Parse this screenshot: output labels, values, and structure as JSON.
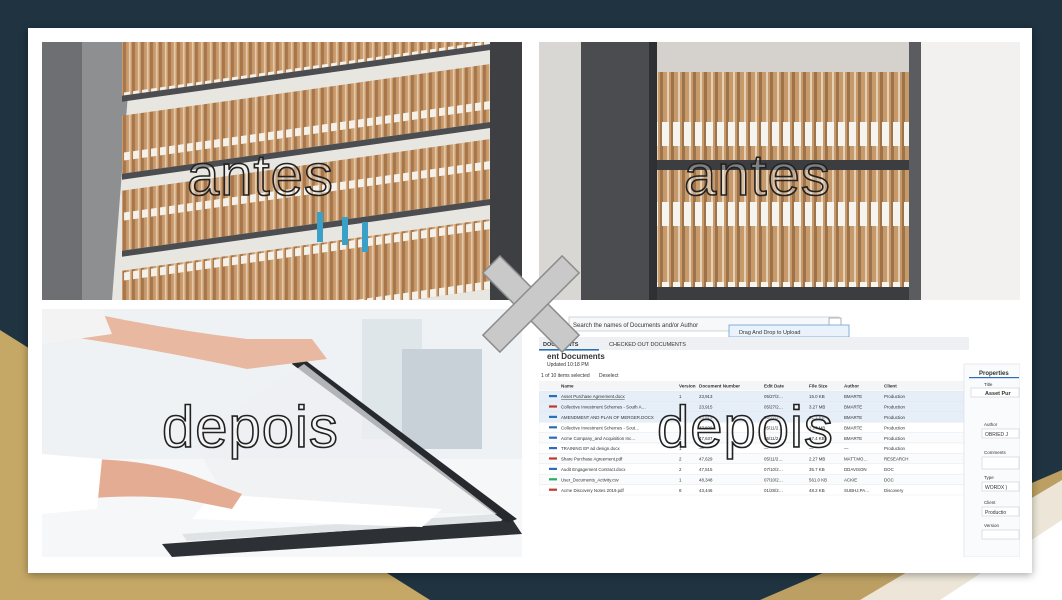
{
  "labels": {
    "before_left": "antes",
    "before_right": "antes",
    "after_left": "depois",
    "after_right": "depois"
  },
  "separator_icon": "x-cross-icon",
  "app_screenshot": {
    "search_placeholder": "Search the names of Documents and/or Author",
    "drop_hint": "Drag And Drop to Upload",
    "tabs": [
      "DOCUMENTS",
      "CHECKED OUT DOCUMENTS"
    ],
    "page_title": "ent Documents",
    "updated": "Updated 10:18 PM",
    "selection_note": "1 of 10 items selected",
    "deselect": "Deselect",
    "columns": [
      "Name",
      "Version",
      "Document Number",
      "Edit Date",
      "File Size",
      "Author",
      "Client"
    ],
    "rows": [
      [
        "Asset Purchase Agreement.docx",
        "1",
        "23,913",
        "05/27/2…",
        "15.0 KB",
        "BMARTE",
        "Production"
      ],
      [
        "Collective Investment Schemes - South A…",
        "1",
        "23,915",
        "05/27/2…",
        "3.27 MB",
        "BMARTE",
        "Production"
      ],
      [
        "AMENDMENT AND PLAN OF MERGER.DOCX",
        "1",
        "23,914",
        "05/27/2…",
        "31.1 KB",
        "BMARTE",
        "Production"
      ],
      [
        "Collective Investment Schemes - Sout…",
        "2",
        "47,829",
        "05/11/2…",
        "3.27 MB",
        "BMARTE",
        "Production"
      ],
      [
        "Acme Company_and Acquisition Inc…",
        "1",
        "47,637",
        "05/11/2…",
        "87.4 KB",
        "BMARTE",
        "Production"
      ],
      [
        "TRAINING EP ad design.docx",
        "1",
        "—",
        "—",
        "—",
        "—",
        "Production"
      ],
      [
        "Share Purchase Agreement.pdf",
        "2",
        "47,629",
        "05/11/2…",
        "2.27 MB",
        "MATT.MO…",
        "RESEARCH"
      ],
      [
        "Audit Engagement Contract.docx",
        "2",
        "47,515",
        "07/10/2…",
        "35.7 KB",
        "DDAVISON",
        "DOC"
      ],
      [
        "User_Documents_Activity.csv",
        "1",
        "48,348",
        "07/10/2…",
        "561.0 KB",
        "ACKIE",
        "DOC"
      ],
      [
        "Acme Discovery Notes 2019.pdf",
        "8",
        "43,446",
        "01/28/2…",
        "48.2 KB",
        "SUBHJ.PA…",
        "Discovery"
      ]
    ],
    "side_panel": {
      "title": "Properties",
      "title_field_label": "Title",
      "title_value": "Asset Pur",
      "author_label": "Author",
      "author_value": "OBRIED J",
      "comments_label": "Comments",
      "type_label": "Type",
      "type_value": "WORDX )",
      "client_label": "Client",
      "client_value": "Productio",
      "version_label": "Version"
    }
  }
}
